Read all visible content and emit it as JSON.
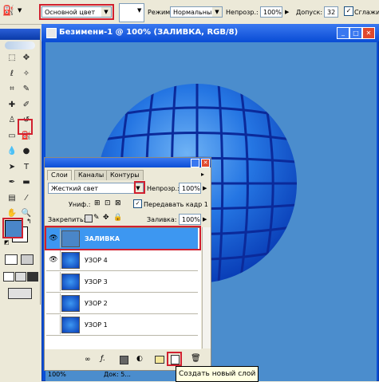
{
  "options_bar": {
    "fill_source": "Основной цвет",
    "mode_label": "Режим:",
    "mode_value": "Нормальный",
    "opacity_label": "Непрозр.:",
    "opacity_value": "100%",
    "tolerance_label": "Допуск:",
    "tolerance_value": "32",
    "antialias_label": "Сглажи"
  },
  "document": {
    "title": "Безимени-1 @ 100% (ЗАЛИВКА, RGB/8)",
    "zoom_status": "100%",
    "doc_status": "Док: 5..."
  },
  "layers_panel": {
    "tabs": [
      "Слои",
      "Каналы",
      "Контуры"
    ],
    "blend_mode": "Жесткий свет",
    "opacity_label": "Непрозр.:",
    "opacity_value": "100%",
    "unify_label": "Униф.:",
    "propagate_label": "Передавать кадр 1",
    "lock_label": "Закрепить:",
    "fill_label": "Заливка:",
    "fill_value": "100%",
    "layers": [
      {
        "name": "ЗАЛИВКА",
        "visible": true,
        "selected": true
      },
      {
        "name": "УЗОР 4",
        "visible": true,
        "selected": false
      },
      {
        "name": "УЗОР 3",
        "visible": false,
        "selected": false
      },
      {
        "name": "УЗОР 2",
        "visible": false,
        "selected": false
      },
      {
        "name": "УЗОР 1",
        "visible": false,
        "selected": false
      }
    ]
  },
  "tooltip": "Создать новый слой",
  "colors": {
    "foreground": "#4a86c8",
    "background": "#ffffff",
    "canvas": "#4b8dcd",
    "sphere": "#1a5fd0",
    "highlight": "#d1202f",
    "selected_layer": "#3d97f1"
  },
  "tool_icons": [
    "marquee-icon",
    "move-icon",
    "lasso-icon",
    "magic-wand-icon",
    "crop-icon",
    "slice-icon",
    "healing-icon",
    "brush-icon",
    "stamp-icon",
    "history-brush-icon",
    "eraser-icon",
    "paint-bucket-icon",
    "blur-icon",
    "dodge-icon",
    "path-select-icon",
    "type-icon",
    "pen-icon",
    "shape-icon",
    "notes-icon",
    "eyedropper-icon",
    "hand-icon",
    "zoom-icon"
  ]
}
